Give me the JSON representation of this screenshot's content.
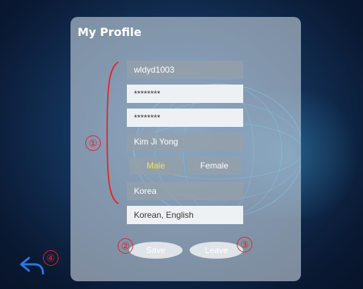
{
  "title": "My Profile",
  "fields": {
    "user_id": "wldyd1003",
    "password": "********",
    "password_confirm": "********",
    "name": "Kim Ji Yong",
    "country": "Korea",
    "languages": "Korean, English"
  },
  "gender": {
    "male": "Male",
    "female": "Female",
    "selected": "Male"
  },
  "actions": {
    "save": "Save",
    "leave": "Leave"
  },
  "annotations": {
    "one": "①",
    "two": "②",
    "three": "③",
    "four": "④"
  },
  "colors": {
    "annotation": "#e82020",
    "selected_text": "#f6e64a",
    "back_icon": "#2a7ae2"
  },
  "icons": {
    "back": "back-arrow-icon"
  }
}
